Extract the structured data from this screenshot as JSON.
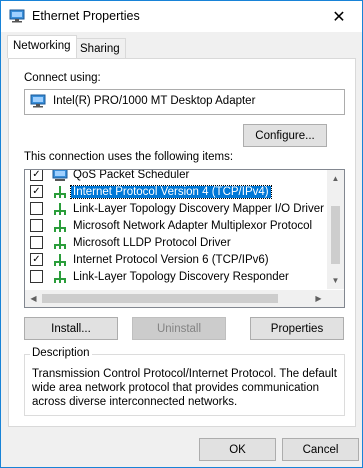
{
  "window": {
    "title": "Ethernet Properties",
    "close_glyph": "✕"
  },
  "tabs": [
    {
      "label": "Networking"
    },
    {
      "label": "Sharing"
    }
  ],
  "connect_using_label": "Connect using:",
  "adapter_name": "Intel(R) PRO/1000 MT Desktop Adapter",
  "configure_button": "Configure...",
  "items_label": "This connection uses the following items:",
  "items": [
    {
      "label": "QoS Packet Scheduler",
      "checked": true,
      "icon": "network-service-icon"
    },
    {
      "label": "Internet Protocol Version 4 (TCP/IPv4)",
      "checked": true,
      "selected": true,
      "icon": "protocol-icon"
    },
    {
      "label": "Link-Layer Topology Discovery Mapper I/O Driver",
      "checked": false,
      "icon": "protocol-icon"
    },
    {
      "label": "Microsoft Network Adapter Multiplexor Protocol",
      "checked": false,
      "icon": "protocol-icon"
    },
    {
      "label": "Microsoft LLDP Protocol Driver",
      "checked": false,
      "icon": "protocol-icon"
    },
    {
      "label": "Internet Protocol Version 6 (TCP/IPv6)",
      "checked": true,
      "icon": "protocol-icon"
    },
    {
      "label": "Link-Layer Topology Discovery Responder",
      "checked": false,
      "icon": "protocol-icon"
    }
  ],
  "buttons": {
    "install": "Install...",
    "uninstall": "Uninstall",
    "properties": "Properties"
  },
  "description": {
    "title": "Description",
    "text": "Transmission Control Protocol/Internet Protocol. The default wide area network protocol that provides communication across diverse interconnected networks."
  },
  "footer": {
    "ok": "OK",
    "cancel": "Cancel"
  },
  "colors": {
    "accent": "#0078d7",
    "border": "#1883d7"
  }
}
